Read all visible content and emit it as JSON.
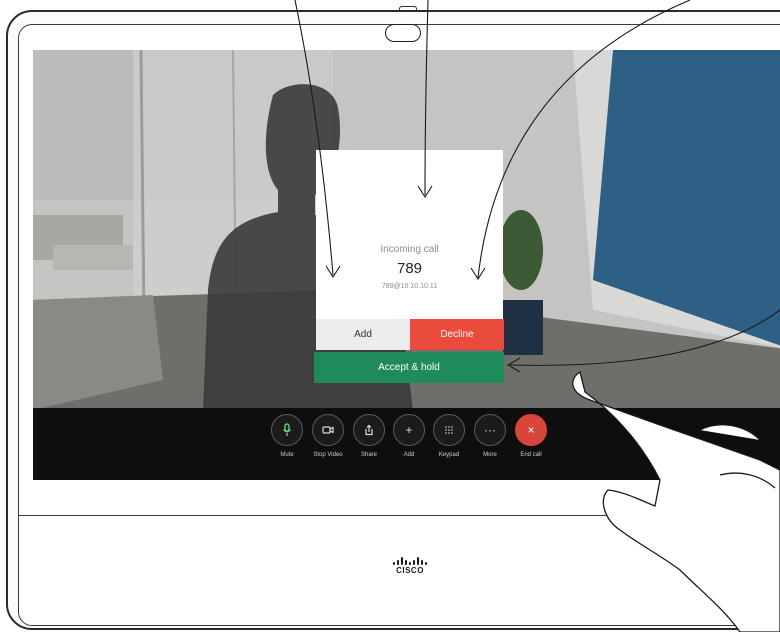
{
  "dialog": {
    "title": "Incoming call",
    "number": "789",
    "address": "789@10.10.10.11"
  },
  "buttons": {
    "add": "Add",
    "decline": "Decline",
    "accept_hold": "Accept & hold"
  },
  "toolbar": {
    "items": [
      {
        "label": "Mute",
        "icon": "microphone-icon"
      },
      {
        "label": "Stop Video",
        "icon": "camera-icon"
      },
      {
        "label": "Share",
        "icon": "share-icon"
      },
      {
        "label": "Add",
        "icon": "plus-icon"
      },
      {
        "label": "Keypad",
        "icon": "keypad-icon"
      },
      {
        "label": "More",
        "icon": "more-icon"
      },
      {
        "label": "End call",
        "icon": "end-call-icon"
      }
    ]
  },
  "brand": {
    "logo_text": "CISCO"
  },
  "colors": {
    "decline": "#eb4b3c",
    "accept": "#1f8a5a",
    "end_call": "#d9453a",
    "mute_active": "#5bd07a",
    "toolbar_bg": "#0e0e0e"
  }
}
